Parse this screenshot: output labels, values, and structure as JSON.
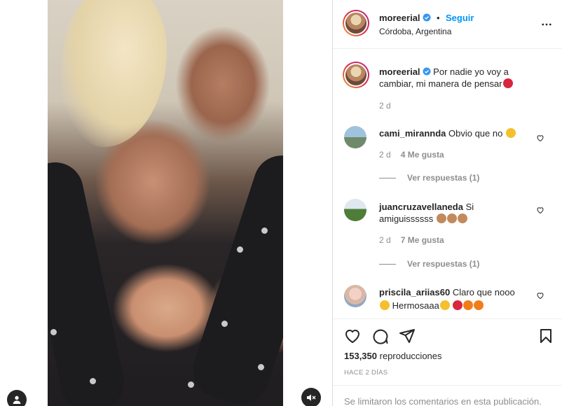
{
  "post": {
    "author": "moreerial",
    "follow_label": "Seguir",
    "separator": "•",
    "location": "Córdoba, Argentina",
    "caption_user": "moreerial",
    "caption_text": "Por nadie yo voy a cambiar, mi manera de pensar",
    "caption_emoji": "devil-emoji",
    "caption_age": "2 d"
  },
  "comments": [
    {
      "user": "cami_mirannda",
      "text": "Obvio que no",
      "emojis": [
        "star-struck-emoji"
      ],
      "age": "2 d",
      "likes": "4 Me gusta",
      "replies_label": "Ver respuestas (1)"
    },
    {
      "user": "juancruzavellaneda",
      "text": "Si amiguissssss",
      "emojis": [
        "clap-emoji",
        "clap-emoji",
        "clap-emoji"
      ],
      "age": "2 d",
      "likes": "7 Me gusta",
      "replies_label": "Ver respuestas (1)"
    },
    {
      "user": "priscila_ariias60",
      "text_line1": "Claro que nooo",
      "text_line2": "Hermosaaa",
      "emojis": [
        "star-struck-emoji",
        "star-struck-emoji",
        "devil-emoji",
        "fire-emoji",
        "fire-emoji"
      ]
    }
  ],
  "stats": {
    "views_count": "153,350",
    "views_label": "reproducciones",
    "date_label": "HACE 2 DÍAS",
    "comments_limited": "Se limitaron los comentarios en esta publicación."
  },
  "colors": {
    "accent": "#0095f6",
    "text": "#262626",
    "muted": "#8e8e8e",
    "border": "#dbdbdb"
  }
}
